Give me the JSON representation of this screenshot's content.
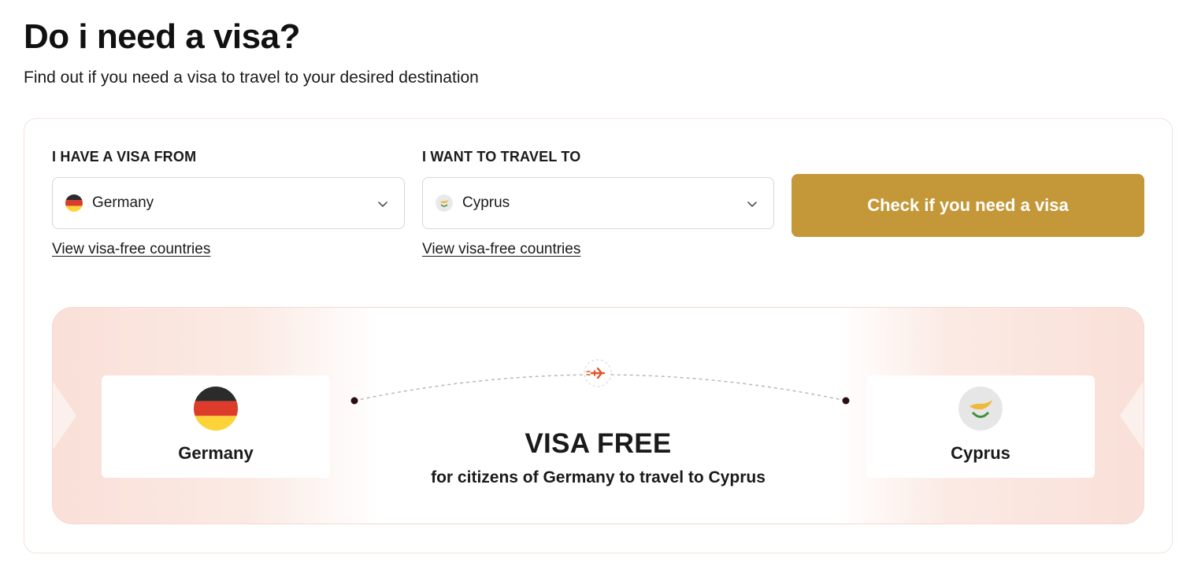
{
  "header": {
    "title": "Do i need a visa?",
    "subtitle": "Find out if you need a visa to travel to your desired destination"
  },
  "form": {
    "from_label": "I HAVE A VISA FROM",
    "from_value": "Germany",
    "from_link": "View visa-free countries",
    "to_label": "I WANT TO TRAVEL TO",
    "to_value": "Cyprus",
    "to_link": "View visa-free countries",
    "check_button": "Check if you need a visa"
  },
  "result": {
    "origin": "Germany",
    "destination": "Cyprus",
    "status": "VISA FREE",
    "description": "for citizens of Germany to travel to Cyprus"
  },
  "icons": {
    "chevron": "chevron-down-icon",
    "plane": "airplane-icon",
    "origin_flag": "germany-flag-icon",
    "destination_flag": "cyprus-flag-icon"
  },
  "colors": {
    "accent": "#c49838",
    "plane": "#e0572c",
    "panel_tint": "#f9e0d8"
  }
}
